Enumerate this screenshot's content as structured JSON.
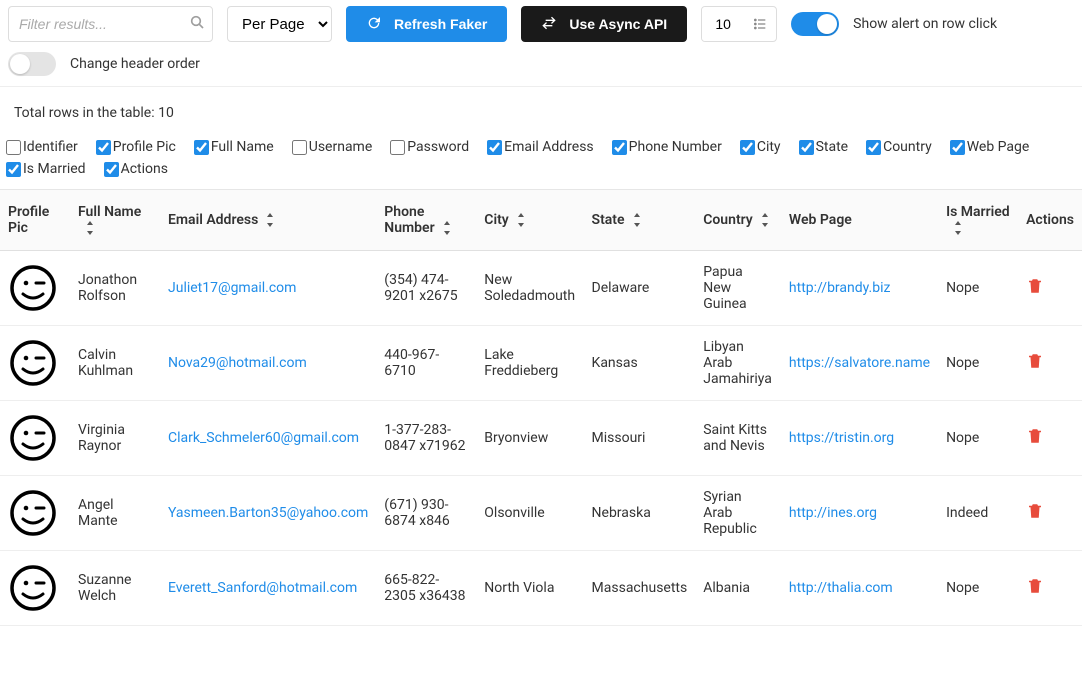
{
  "toolbar": {
    "filter_placeholder": "Filter results...",
    "per_page_label": "Per Page",
    "refresh_label": "Refresh Faker",
    "async_label": "Use Async API",
    "count_value": "10",
    "show_alert_label": "Show alert on row click",
    "change_header_label": "Change header order"
  },
  "summary": {
    "total_rows_text": "Total rows in the table: 10"
  },
  "column_toggles": [
    {
      "label": "Identifier",
      "checked": false
    },
    {
      "label": "Profile Pic",
      "checked": true
    },
    {
      "label": "Full Name",
      "checked": true
    },
    {
      "label": "Username",
      "checked": false
    },
    {
      "label": "Password",
      "checked": false
    },
    {
      "label": "Email Address",
      "checked": true
    },
    {
      "label": "Phone Number",
      "checked": true
    },
    {
      "label": "City",
      "checked": true
    },
    {
      "label": "State",
      "checked": true
    },
    {
      "label": "Country",
      "checked": true
    },
    {
      "label": "Web Page",
      "checked": true
    },
    {
      "label": "Is Married",
      "checked": true
    },
    {
      "label": "Actions",
      "checked": true
    }
  ],
  "headers": {
    "profile_pic": "Profile Pic",
    "full_name": "Full Name",
    "email": "Email Address",
    "phone": "Phone Number",
    "city": "City",
    "state": "State",
    "country": "Country",
    "web_page": "Web Page",
    "is_married": "Is Married",
    "actions": "Actions"
  },
  "rows": [
    {
      "full_name": "Jonathon Rolfson",
      "email": "Juliet17@gmail.com",
      "phone": "(354) 474-9201 x2675",
      "city": "New Soledadmouth",
      "state": "Delaware",
      "country": "Papua New Guinea",
      "web_page": "http://brandy.biz",
      "is_married": "Nope"
    },
    {
      "full_name": "Calvin Kuhlman",
      "email": "Nova29@hotmail.com",
      "phone": "440-967-6710",
      "city": "Lake Freddieberg",
      "state": "Kansas",
      "country": "Libyan Arab Jamahiriya",
      "web_page": "https://salvatore.name",
      "is_married": "Nope"
    },
    {
      "full_name": "Virginia Raynor",
      "email": "Clark_Schmeler60@gmail.com",
      "phone": "1-377-283-0847 x71962",
      "city": "Bryonview",
      "state": "Missouri",
      "country": "Saint Kitts and Nevis",
      "web_page": "https://tristin.org",
      "is_married": "Nope"
    },
    {
      "full_name": "Angel Mante",
      "email": "Yasmeen.Barton35@yahoo.com",
      "phone": "(671) 930-6874 x846",
      "city": "Olsonville",
      "state": "Nebraska",
      "country": "Syrian Arab Republic",
      "web_page": "http://ines.org",
      "is_married": "Indeed"
    },
    {
      "full_name": "Suzanne Welch",
      "email": "Everett_Sanford@hotmail.com",
      "phone": "665-822-2305 x36438",
      "city": "North Viola",
      "state": "Massachusetts",
      "country": "Albania",
      "web_page": "http://thalia.com",
      "is_married": "Nope"
    }
  ]
}
